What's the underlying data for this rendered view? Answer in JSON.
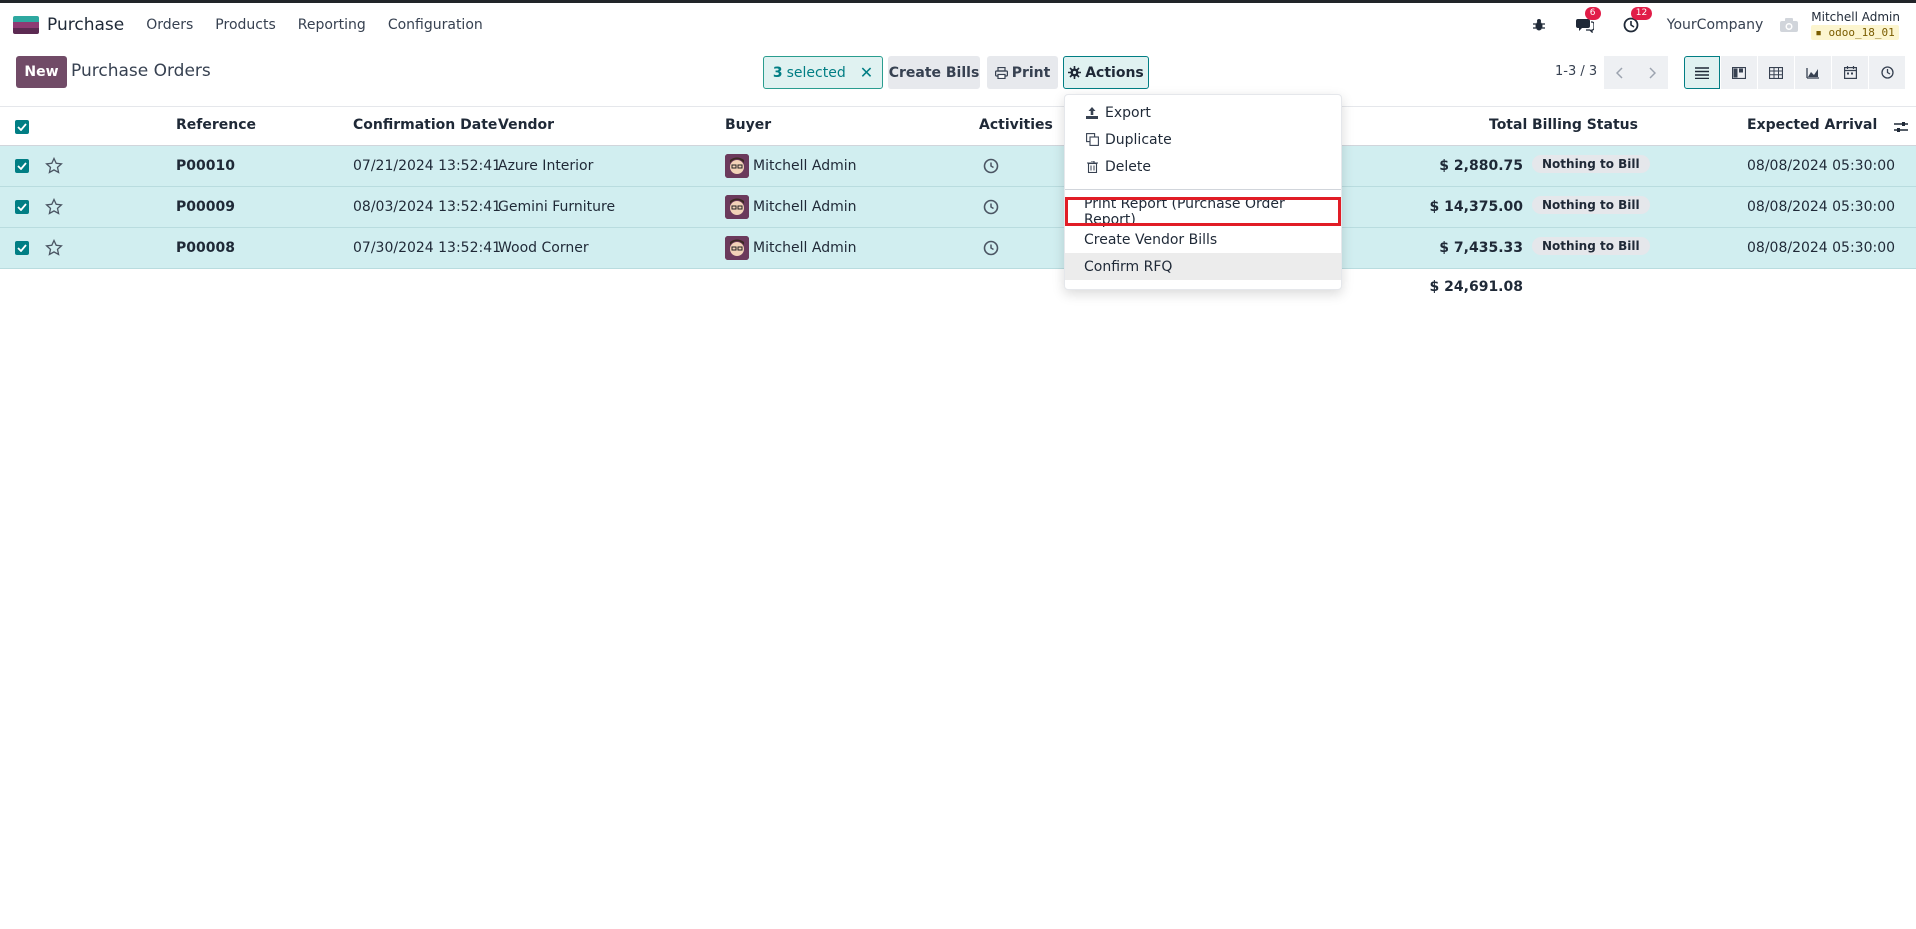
{
  "navbar": {
    "app_name": "Purchase",
    "menu": [
      "Orders",
      "Products",
      "Reporting",
      "Configuration"
    ],
    "messages_count": "6",
    "activities_count": "12",
    "company": "YourCompany",
    "user_name": "Mitchell Admin",
    "db_name": "odoo_18_01"
  },
  "control_panel": {
    "new_label": "New",
    "title": "Purchase Orders",
    "selected_count": "3",
    "selected_label": "selected",
    "create_bills_label": "Create Bills",
    "print_label": "Print",
    "actions_label": "Actions",
    "pager": "1-3 / 3"
  },
  "list": {
    "columns": {
      "reference": "Reference",
      "confirmation_date": "Confirmation Date",
      "vendor": "Vendor",
      "buyer": "Buyer",
      "activities": "Activities",
      "total": "Total",
      "billing_status": "Billing Status",
      "expected_arrival": "Expected Arrival"
    },
    "rows": [
      {
        "reference": "P00010",
        "confirmation_date": "07/21/2024 13:52:41",
        "vendor": "Azure Interior",
        "buyer": "Mitchell Admin",
        "total": "$ 2,880.75",
        "billing_status": "Nothing to Bill",
        "expected_arrival": "08/08/2024 05:30:00"
      },
      {
        "reference": "P00009",
        "confirmation_date": "08/03/2024 13:52:41",
        "vendor": "Gemini Furniture",
        "buyer": "Mitchell Admin",
        "total": "$ 14,375.00",
        "billing_status": "Nothing to Bill",
        "expected_arrival": "08/08/2024 05:30:00"
      },
      {
        "reference": "P00008",
        "confirmation_date": "07/30/2024 13:52:41",
        "vendor": "Wood Corner",
        "buyer": "Mitchell Admin",
        "total": "$ 7,435.33",
        "billing_status": "Nothing to Bill",
        "expected_arrival": "08/08/2024 05:30:00"
      }
    ],
    "total_sum": "$ 24,691.08"
  },
  "actions_menu": {
    "export": "Export",
    "duplicate": "Duplicate",
    "delete": "Delete",
    "print_report": "Print Report (Purchase Order Report)",
    "create_vendor_bills": "Create Vendor Bills",
    "confirm_rfq": "Confirm RFQ"
  },
  "colors": {
    "brand": "#714b67",
    "accent": "#017e84",
    "selected_row": "#d1eef0",
    "highlight_box": "#e11d26"
  }
}
